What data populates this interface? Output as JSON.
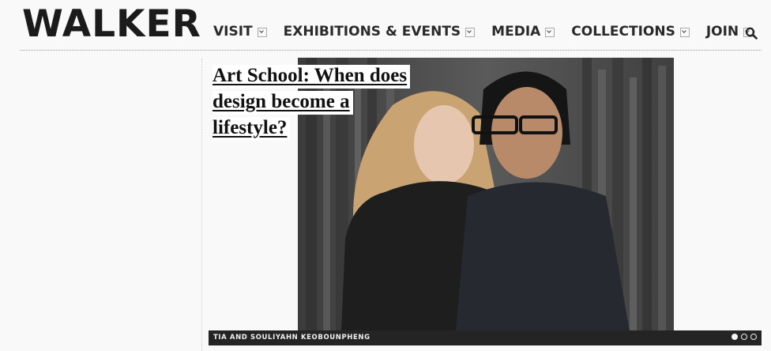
{
  "site": {
    "logo": "WALKER"
  },
  "nav": {
    "items": [
      {
        "label": "VISIT"
      },
      {
        "label": "EXHIBITIONS & EVENTS"
      },
      {
        "label": "MEDIA"
      },
      {
        "label": "COLLECTIONS"
      },
      {
        "label": "JOIN"
      }
    ],
    "search_icon": "search-icon"
  },
  "feature": {
    "title_lines": [
      "Art School: When does",
      "design become a",
      "lifestyle?"
    ],
    "caption": "TIA AND SOULIYAHN KEOBOUNPHENG",
    "slides_total": 3,
    "slide_active": 1
  },
  "colors": {
    "background": "#f9f9f9",
    "text": "#1b1b1b",
    "caption_bar": "#242424"
  }
}
